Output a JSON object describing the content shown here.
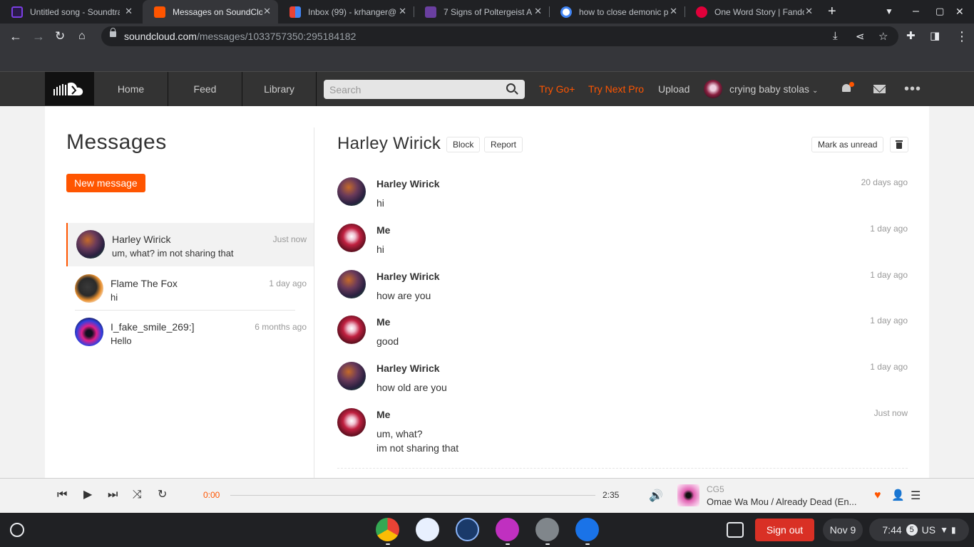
{
  "browser": {
    "tabs": [
      {
        "title": "Untitled song - Soundtrap",
        "fav_color": "#7b3fe4"
      },
      {
        "title": "Messages on SoundCloud",
        "fav_color": "#ff5500"
      },
      {
        "title": "Inbox (99) - krhanger@",
        "fav_color": "#ea4335"
      },
      {
        "title": "7 Signs of Poltergeist A",
        "fav_color": "#6a3fa0"
      },
      {
        "title": "how to close demonic p",
        "fav_color": "#4285f4"
      },
      {
        "title": "One Word Story | Fando",
        "fav_color": "#e0003a"
      }
    ],
    "url_host": "soundcloud.com",
    "url_path": "/messages/1033757350:295184182"
  },
  "header": {
    "nav": [
      "Home",
      "Feed",
      "Library"
    ],
    "search_placeholder": "Search",
    "try_go": "Try Go+",
    "try_next": "Try Next Pro",
    "upload": "Upload",
    "username": "crying baby stolas",
    "accent": "#ff5500"
  },
  "sidebar": {
    "title": "Messages",
    "new_message": "New message",
    "conversations": [
      {
        "name": "Harley Wirick",
        "preview": "um, what? im not sharing that",
        "time": "Just now"
      },
      {
        "name": "Flame The Fox",
        "preview": "hi",
        "time": "1 day ago"
      },
      {
        "name": "I_fake_smile_269:]",
        "preview": "Hello",
        "time": "6 months ago"
      }
    ]
  },
  "conversation": {
    "title": "Harley Wirick",
    "block": "Block",
    "report": "Report",
    "mark_unread": "Mark as unread",
    "messages": [
      {
        "sender": "Harley Wirick",
        "text": "hi",
        "time": "20 days ago"
      },
      {
        "sender": "Me",
        "text": "hi",
        "time": "1 day ago"
      },
      {
        "sender": "Harley Wirick",
        "text": "how are you",
        "time": "1 day ago"
      },
      {
        "sender": "Me",
        "text": "good",
        "time": "1 day ago"
      },
      {
        "sender": "Harley Wirick",
        "text": "how old are you",
        "time": "1 day ago"
      },
      {
        "sender": "Me",
        "text": "um, what?",
        "text2": "im not sharing that",
        "time": "Just now"
      }
    ]
  },
  "player": {
    "current": "0:00",
    "duration": "2:35",
    "artist": "CG5",
    "track": "Omae Wa Mou / Already Dead (En..."
  },
  "shelf": {
    "sign_out": "Sign out",
    "date": "Nov 9",
    "time": "7:44",
    "notif_count": "5",
    "locale": "US"
  }
}
